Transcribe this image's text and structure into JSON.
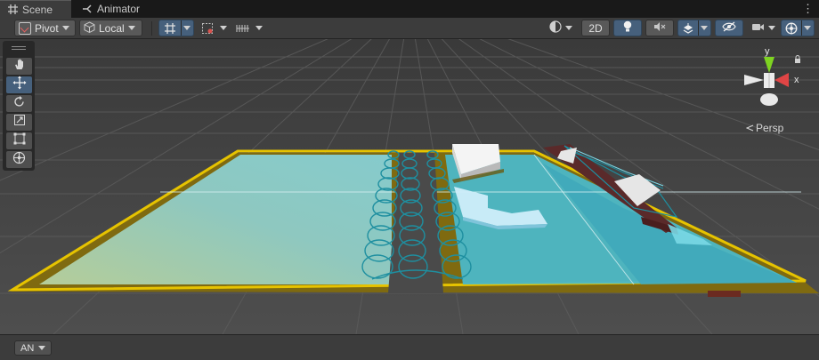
{
  "tabs": [
    {
      "label": "Scene",
      "icon": "grid-icon"
    },
    {
      "label": "Animator",
      "icon": "animator-icon"
    }
  ],
  "toolbar": {
    "pivot_label": "Pivot",
    "space_label": "Local",
    "mode_2d_label": "2D"
  },
  "gizmo": {
    "x_label": "x",
    "y_label": "y",
    "projection_label": "Persp"
  },
  "bottom": {
    "dropdown_value": "AN"
  },
  "colors": {
    "active_button": "#46607c",
    "water": "#4cb8c8",
    "outline_yellow": "#e6c300",
    "ring_teal": "#1e8fa0",
    "axis_x": "#e04545",
    "axis_y": "#7ed321"
  }
}
